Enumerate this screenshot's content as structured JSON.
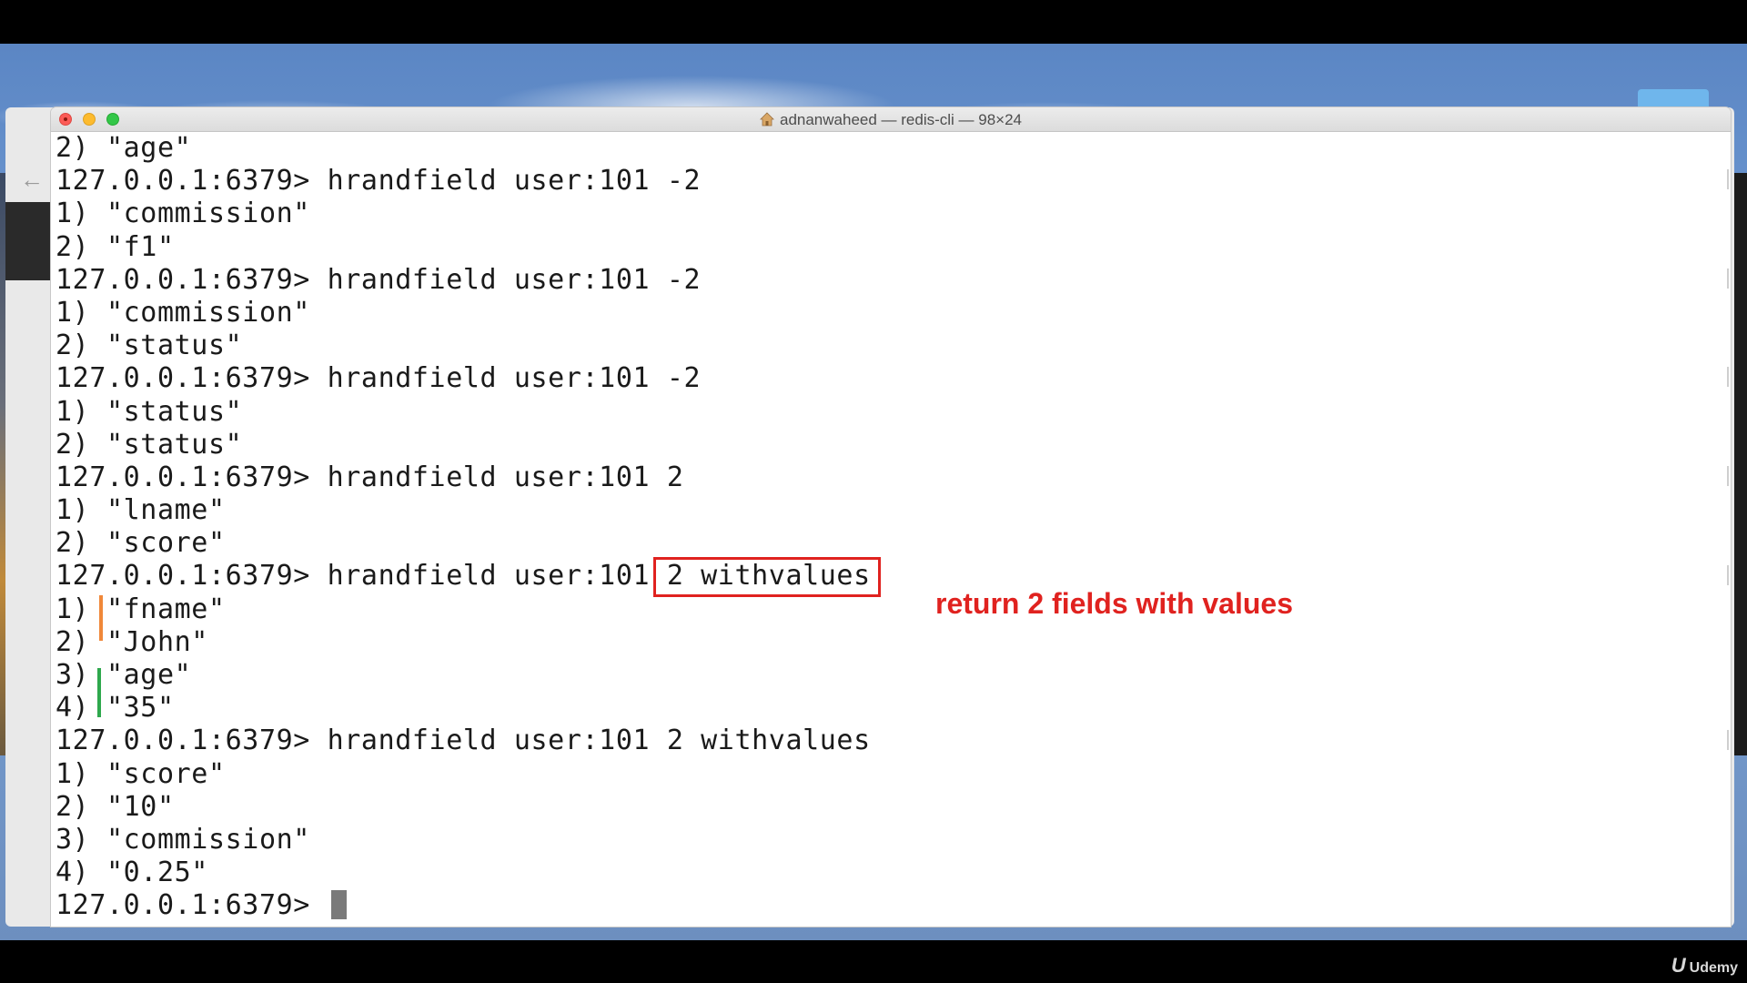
{
  "window": {
    "title": "adnanwaheed — redis-cli — 98×24"
  },
  "terminal": {
    "lines": [
      "2) \"age\"",
      "127.0.0.1:6379> hrandfield user:101 -2",
      "1) \"commission\"",
      "2) \"f1\"",
      "127.0.0.1:6379> hrandfield user:101 -2",
      "1) \"commission\"",
      "2) \"status\"",
      "127.0.0.1:6379> hrandfield user:101 -2",
      "1) \"status\"",
      "2) \"status\"",
      "127.0.0.1:6379> hrandfield user:101 2",
      "1) \"lname\"",
      "2) \"score\"",
      "127.0.0.1:6379> hrandfield user:101 2 withvalues",
      "1) \"fname\"",
      "2) \"John\"",
      "3) \"age\"",
      "4) \"35\"",
      "127.0.0.1:6379> hrandfield user:101 2 withvalues",
      "1) \"score\"",
      "2) \"10\"",
      "3) \"commission\"",
      "4) \"0.25\""
    ],
    "prompt": "127.0.0.1:6379> "
  },
  "annotation": {
    "text": "return 2 fields with values",
    "color": "#e0221f"
  },
  "colors": {
    "orange_bracket": "#f0883a",
    "green_bracket": "#2ea84d"
  },
  "watermark": {
    "logo_mark": "U",
    "text": "Udemy"
  }
}
